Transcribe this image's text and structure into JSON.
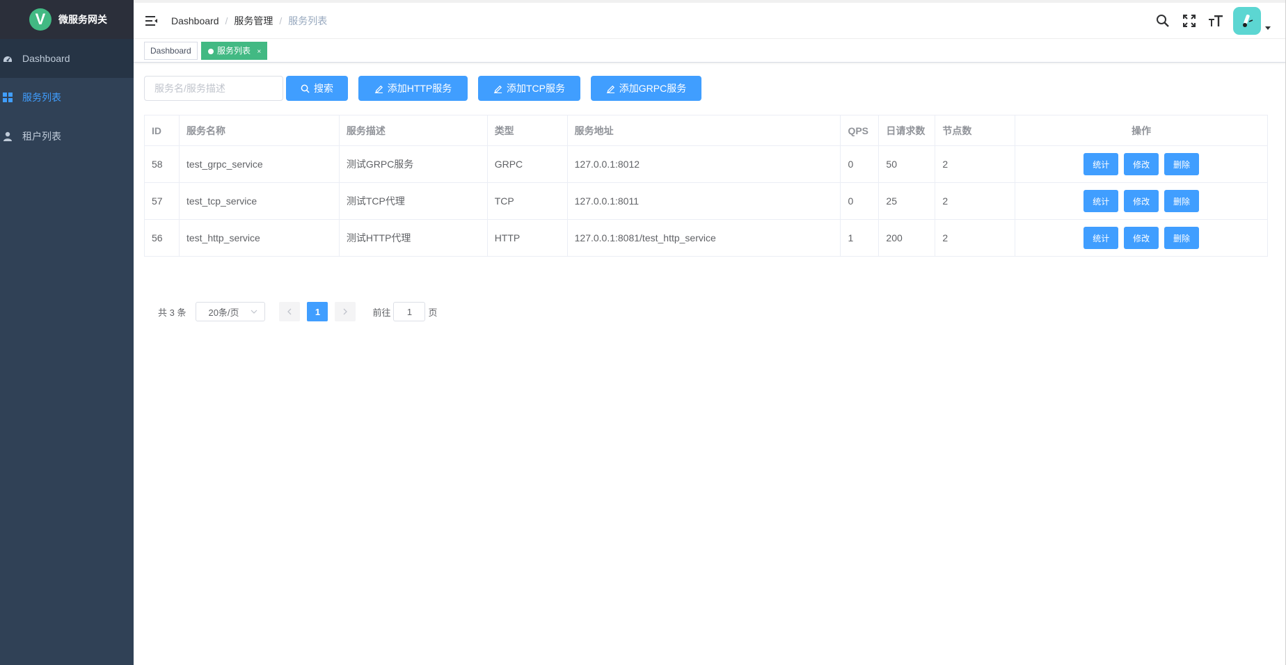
{
  "app": {
    "logo_letter": "V",
    "title": "微服务网关"
  },
  "sidebar": {
    "items": [
      {
        "label": "Dashboard",
        "icon": "dashboard-icon"
      },
      {
        "label": "服务列表",
        "icon": "grid-icon"
      },
      {
        "label": "租户列表",
        "icon": "user-icon"
      }
    ]
  },
  "navbar": {
    "breadcrumb": [
      "Dashboard",
      "服务管理",
      "服务列表"
    ],
    "icons": [
      "search-icon",
      "fullscreen-icon",
      "font-size-icon"
    ]
  },
  "tags": [
    {
      "label": "Dashboard"
    },
    {
      "label": "服务列表",
      "close": "×"
    }
  ],
  "filter": {
    "placeholder": "服务名/服务描述",
    "search_label": "搜索",
    "add_http_label": "添加HTTP服务",
    "add_tcp_label": "添加TCP服务",
    "add_grpc_label": "添加GRPC服务"
  },
  "table": {
    "headers": [
      "ID",
      "服务名称",
      "服务描述",
      "类型",
      "服务地址",
      "QPS",
      "日请求数",
      "节点数",
      "操作"
    ],
    "rows": [
      {
        "id": "58",
        "name": "test_grpc_service",
        "desc": "测试GRPC服务",
        "type": "GRPC",
        "addr": "127.0.0.1:8012",
        "qps": "0",
        "qpd": "50",
        "nodes": "2"
      },
      {
        "id": "57",
        "name": "test_tcp_service",
        "desc": "测试TCP代理",
        "type": "TCP",
        "addr": "127.0.0.1:8011",
        "qps": "0",
        "qpd": "25",
        "nodes": "2"
      },
      {
        "id": "56",
        "name": "test_http_service",
        "desc": "测试HTTP代理",
        "type": "HTTP",
        "addr": "127.0.0.1:8081/test_http_service",
        "qps": "1",
        "qpd": "200",
        "nodes": "2"
      }
    ],
    "actions": {
      "stats": "统计",
      "edit": "修改",
      "delete": "删除"
    }
  },
  "pagination": {
    "total": "共 3 条",
    "page_size": "20条/页",
    "current": "1",
    "goto_prefix": "前往",
    "goto_value": "1",
    "goto_suffix": "页"
  },
  "colors": {
    "primary": "#409eff",
    "sidebar": "#304156",
    "accent": "#42b983"
  }
}
